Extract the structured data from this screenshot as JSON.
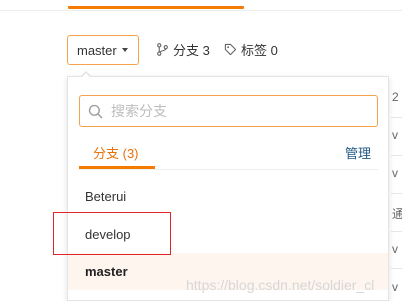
{
  "toolbar": {
    "branch_selector_label": "master",
    "branches_stat": "分支 3",
    "tags_stat": "标签 0"
  },
  "dropdown": {
    "search_placeholder": "搜索分支",
    "tab_branches": "分支 (3)",
    "manage_link": "管理",
    "branches": [
      "Beterui",
      "develop",
      "master"
    ]
  },
  "side_column": {
    "fragments": [
      "2",
      "v",
      "v",
      "通",
      "v",
      "v"
    ]
  },
  "watermark": "https://blog.csdn.net/soldier_cl",
  "colors": {
    "accent": "#f57c00",
    "accent_text": "#e8720c",
    "link": "#1f5a84",
    "highlight_box": "#e0262a"
  }
}
